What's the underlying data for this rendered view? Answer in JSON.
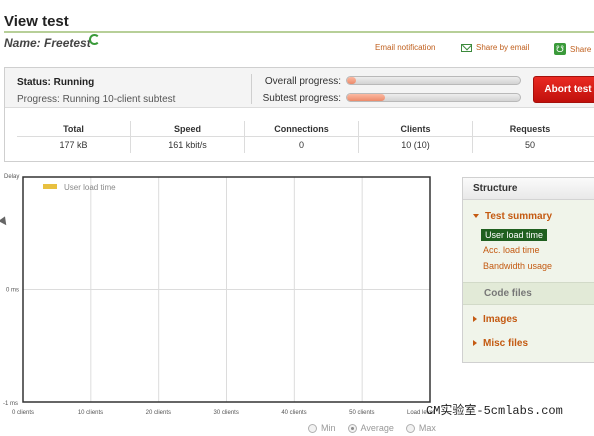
{
  "header": {
    "title": "View test",
    "name_label": "Name: Freetest"
  },
  "top_actions": {
    "email_notification": "Email notification",
    "share_by_email": "Share by email",
    "share": "Share"
  },
  "status": {
    "status_label": "Status: Running",
    "progress_label": "Progress: Running 10-client subtest",
    "overall_progress_label": "Overall progress:",
    "overall_progress_value": 0.05,
    "subtest_progress_label": "Subtest progress:",
    "subtest_progress_value": 0.22,
    "abort_button": "Abort test"
  },
  "stats": {
    "headers": [
      "Total",
      "Speed",
      "Connections",
      "Clients",
      "Requests"
    ],
    "values": [
      "177 kB",
      "161 kbit/s",
      "0",
      "10 (10)",
      "50"
    ]
  },
  "chart_data": {
    "type": "line",
    "ylabel": "Delay",
    "y_ticks": [
      "0 ms",
      "-1 ms"
    ],
    "x_ticks": [
      "0 clients",
      "10 clients",
      "20 clients",
      "30 clients",
      "40 clients",
      "50 clients"
    ],
    "xlabel": "Load level",
    "ylim": [
      -1,
      1
    ],
    "xlim": [
      0,
      60
    ],
    "series": [
      {
        "name": "User load time",
        "color": "#e8c040",
        "values": []
      }
    ],
    "legend_position": "top-left",
    "grid": true
  },
  "structure": {
    "title": "Structure",
    "groups": [
      {
        "label": "Test summary",
        "expanded": true
      },
      {
        "label": "Code files"
      },
      {
        "label": "Images"
      },
      {
        "label": "Misc files"
      }
    ],
    "summary_items": [
      "User load time",
      "Acc. load time",
      "Bandwidth usage"
    ],
    "active_item": "User load time"
  },
  "view_options": {
    "options": [
      "Min",
      "Average",
      "Max"
    ],
    "selected": "Average"
  },
  "watermark": "CM实验室-5cmlabs.com",
  "colors": {
    "accent": "#c0601e",
    "rule": "#b7cf98",
    "abort": "#d61a14",
    "active_item_bg": "#1f5f1f",
    "legend_swatch": "#e8c040"
  }
}
